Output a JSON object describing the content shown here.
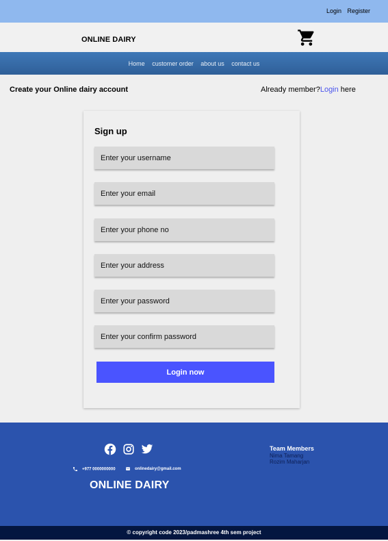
{
  "topbar": {
    "login": "Login",
    "register": "Register"
  },
  "header": {
    "brand": "ONLINE DAIRY",
    "cart_icon": "cart-icon"
  },
  "nav": {
    "items": [
      "Home",
      "customer order",
      "about us",
      "contact us"
    ]
  },
  "subhead": {
    "title": "Create your Online dairy account",
    "already_prefix": "Already member?",
    "login_link": "Login",
    "already_suffix": " here"
  },
  "form": {
    "title": "Sign up",
    "fields": [
      {
        "placeholder": "Enter your username"
      },
      {
        "placeholder": "Enter your email"
      },
      {
        "placeholder": "Enter your phone no"
      },
      {
        "placeholder": "Enter your address"
      },
      {
        "placeholder": "Enter your password"
      },
      {
        "placeholder": "Enter your confirm password"
      }
    ],
    "submit": "Login now"
  },
  "footer": {
    "social_icons": [
      "facebook-icon",
      "instagram-icon",
      "twitter-icon"
    ],
    "phone": "+977 0000000000",
    "email": "onlinedairy@gmail.com",
    "brand": "ONLINE DAIRY",
    "team_title": "Team Members",
    "members": [
      "Nima Tamang",
      "Rozim Maharjan"
    ],
    "copyright": "© copyright code 2023/padmashree 4th sem project"
  },
  "colors": {
    "topbar": "#8fb8ee",
    "nav": "#3f78b7",
    "button": "#4a54ff",
    "footer": "#2b53ad",
    "copyright_bar": "#041640",
    "link": "#4a54ee"
  }
}
